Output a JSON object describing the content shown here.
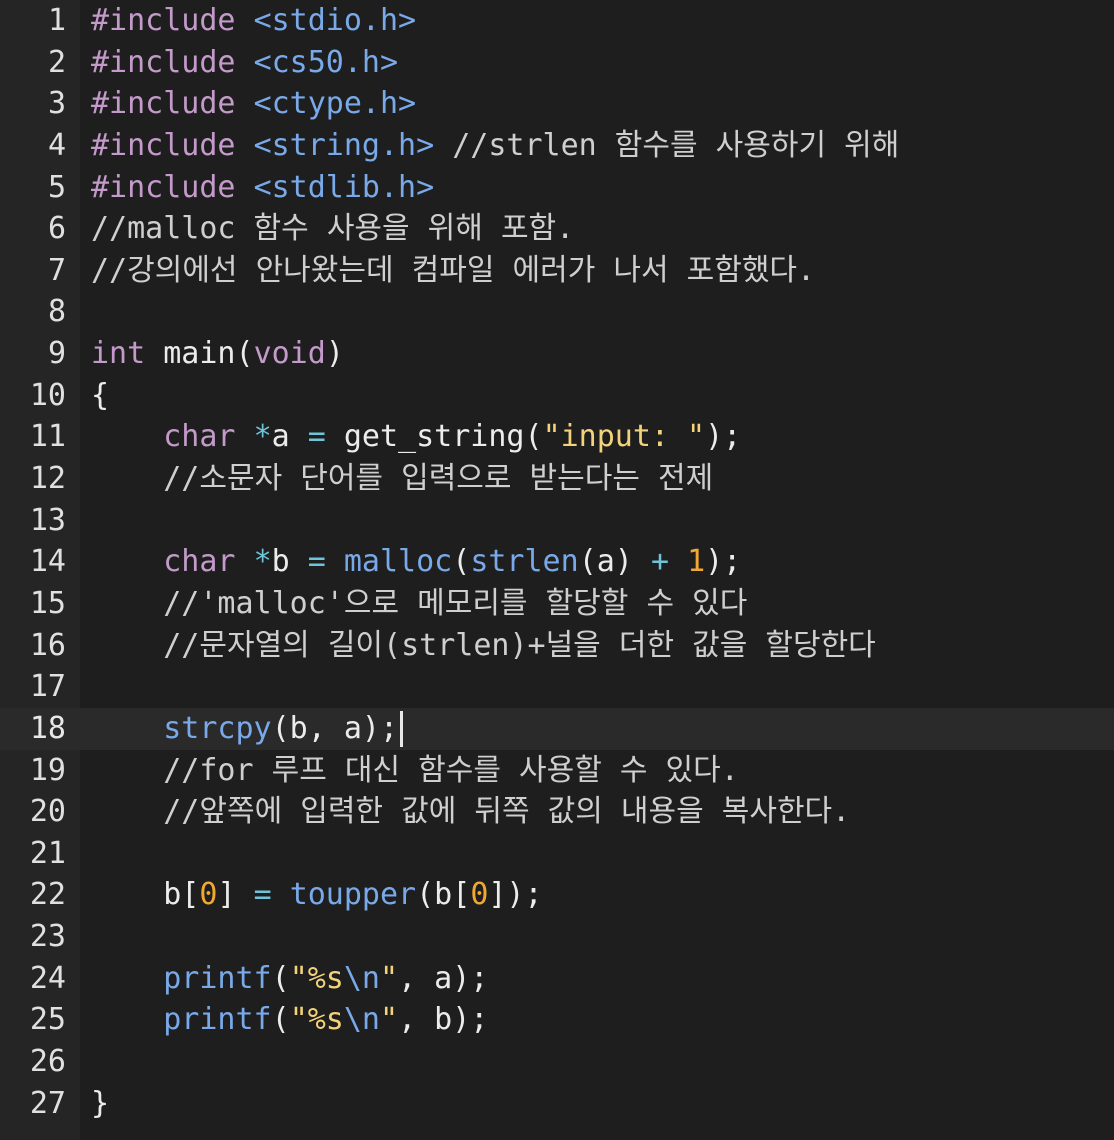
{
  "editor": {
    "active_line": 18,
    "colors": {
      "background": "#1e1e1e",
      "gutter": "#252526",
      "keyword": "#c39ac9",
      "header": "#79a9e8",
      "string": "#f3d37a",
      "number": "#f0a830",
      "operator": "#6ec4d8",
      "comment": "#cfcfcf",
      "text": "#ececec"
    },
    "lines": [
      {
        "n": "1",
        "tokens": [
          {
            "t": "#include ",
            "c": "keyword"
          },
          {
            "t": "<stdio.h>",
            "c": "header"
          }
        ]
      },
      {
        "n": "2",
        "tokens": [
          {
            "t": "#include ",
            "c": "keyword"
          },
          {
            "t": "<cs50.h>",
            "c": "header"
          }
        ]
      },
      {
        "n": "3",
        "tokens": [
          {
            "t": "#include ",
            "c": "keyword"
          },
          {
            "t": "<ctype.h>",
            "c": "header"
          }
        ]
      },
      {
        "n": "4",
        "tokens": [
          {
            "t": "#include ",
            "c": "keyword"
          },
          {
            "t": "<string.h>",
            "c": "header"
          },
          {
            "t": " //strlen 함수를 사용하기 위해",
            "c": "comment"
          }
        ]
      },
      {
        "n": "5",
        "tokens": [
          {
            "t": "#include ",
            "c": "keyword"
          },
          {
            "t": "<stdlib.h>",
            "c": "header"
          }
        ]
      },
      {
        "n": "6",
        "tokens": [
          {
            "t": "//malloc 함수 사용을 위해 포함.",
            "c": "comment"
          }
        ]
      },
      {
        "n": "7",
        "tokens": [
          {
            "t": "//강의에선 안나왔는데 컴파일 에러가 나서 포함했다.",
            "c": "comment"
          }
        ]
      },
      {
        "n": "8",
        "tokens": []
      },
      {
        "n": "9",
        "tokens": [
          {
            "t": "int",
            "c": "type"
          },
          {
            "t": " main(",
            "c": "plain"
          },
          {
            "t": "void",
            "c": "type"
          },
          {
            "t": ")",
            "c": "plain"
          }
        ]
      },
      {
        "n": "10",
        "tokens": [
          {
            "t": "{",
            "c": "plain"
          }
        ]
      },
      {
        "n": "11",
        "tokens": [
          {
            "t": "    ",
            "c": "plain"
          },
          {
            "t": "char",
            "c": "type"
          },
          {
            "t": " ",
            "c": "plain"
          },
          {
            "t": "*",
            "c": "operator"
          },
          {
            "t": "a ",
            "c": "plain"
          },
          {
            "t": "=",
            "c": "operator"
          },
          {
            "t": " get_string(",
            "c": "plain"
          },
          {
            "t": "\"input: \"",
            "c": "string"
          },
          {
            "t": ");",
            "c": "plain"
          }
        ]
      },
      {
        "n": "12",
        "tokens": [
          {
            "t": "    //소문자 단어를 입력으로 받는다는 전제",
            "c": "comment"
          }
        ]
      },
      {
        "n": "13",
        "tokens": []
      },
      {
        "n": "14",
        "tokens": [
          {
            "t": "    ",
            "c": "plain"
          },
          {
            "t": "char",
            "c": "type"
          },
          {
            "t": " ",
            "c": "plain"
          },
          {
            "t": "*",
            "c": "operator"
          },
          {
            "t": "b ",
            "c": "plain"
          },
          {
            "t": "=",
            "c": "operator"
          },
          {
            "t": " ",
            "c": "plain"
          },
          {
            "t": "malloc",
            "c": "function"
          },
          {
            "t": "(",
            "c": "plain"
          },
          {
            "t": "strlen",
            "c": "function"
          },
          {
            "t": "(a) ",
            "c": "plain"
          },
          {
            "t": "+",
            "c": "operator"
          },
          {
            "t": " ",
            "c": "plain"
          },
          {
            "t": "1",
            "c": "number"
          },
          {
            "t": ");",
            "c": "plain"
          }
        ]
      },
      {
        "n": "15",
        "tokens": [
          {
            "t": "    //'malloc'으로 메모리를 할당할 수 있다",
            "c": "comment"
          }
        ]
      },
      {
        "n": "16",
        "tokens": [
          {
            "t": "    //문자열의 길이(strlen)+널을 더한 값을 할당한다",
            "c": "comment"
          }
        ]
      },
      {
        "n": "17",
        "tokens": []
      },
      {
        "n": "18",
        "tokens": [
          {
            "t": "    ",
            "c": "plain"
          },
          {
            "t": "strcpy",
            "c": "function"
          },
          {
            "t": "(b, a);",
            "c": "plain"
          }
        ],
        "cursor": true
      },
      {
        "n": "19",
        "tokens": [
          {
            "t": "    //for 루프 대신 함수를 사용할 수 있다.",
            "c": "comment"
          }
        ]
      },
      {
        "n": "20",
        "tokens": [
          {
            "t": "    //앞쪽에 입력한 값에 뒤쪽 값의 내용을 복사한다.",
            "c": "comment"
          }
        ]
      },
      {
        "n": "21",
        "tokens": []
      },
      {
        "n": "22",
        "tokens": [
          {
            "t": "    b[",
            "c": "plain"
          },
          {
            "t": "0",
            "c": "number"
          },
          {
            "t": "] ",
            "c": "plain"
          },
          {
            "t": "=",
            "c": "operator"
          },
          {
            "t": " ",
            "c": "plain"
          },
          {
            "t": "toupper",
            "c": "function"
          },
          {
            "t": "(b[",
            "c": "plain"
          },
          {
            "t": "0",
            "c": "number"
          },
          {
            "t": "]);",
            "c": "plain"
          }
        ]
      },
      {
        "n": "23",
        "tokens": []
      },
      {
        "n": "24",
        "tokens": [
          {
            "t": "    ",
            "c": "plain"
          },
          {
            "t": "printf",
            "c": "function"
          },
          {
            "t": "(",
            "c": "plain"
          },
          {
            "t": "\"%s",
            "c": "string"
          },
          {
            "t": "\\n",
            "c": "escape"
          },
          {
            "t": "\"",
            "c": "string"
          },
          {
            "t": ", a);",
            "c": "plain"
          }
        ]
      },
      {
        "n": "25",
        "tokens": [
          {
            "t": "    ",
            "c": "plain"
          },
          {
            "t": "printf",
            "c": "function"
          },
          {
            "t": "(",
            "c": "plain"
          },
          {
            "t": "\"%s",
            "c": "string"
          },
          {
            "t": "\\n",
            "c": "escape"
          },
          {
            "t": "\"",
            "c": "string"
          },
          {
            "t": ", b);",
            "c": "plain"
          }
        ]
      },
      {
        "n": "26",
        "tokens": []
      },
      {
        "n": "27",
        "tokens": [
          {
            "t": "}",
            "c": "plain"
          }
        ]
      }
    ]
  }
}
